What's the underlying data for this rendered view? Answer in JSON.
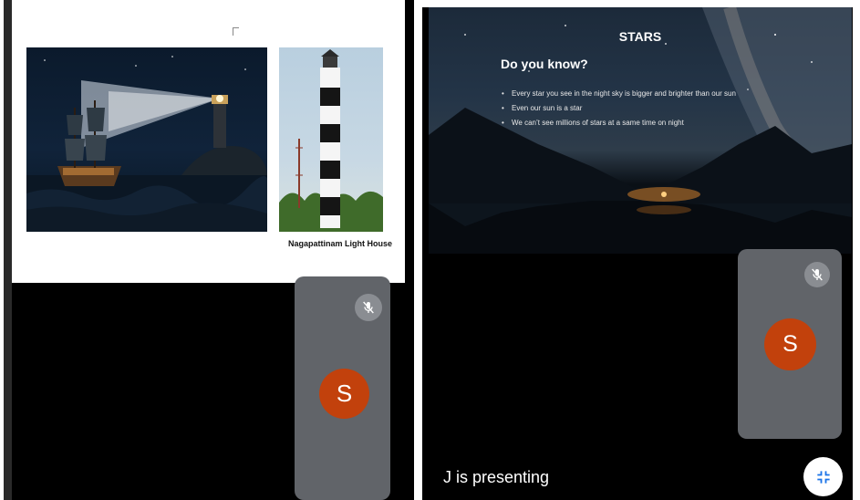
{
  "left_pane": {
    "slide": {
      "caption": "Nagapattinam Light House"
    },
    "participant_tile": {
      "avatar_initial": "S",
      "avatar_color": "#c2410c",
      "mic_icon": "mic-off-icon"
    }
  },
  "right_pane": {
    "slide": {
      "title": "STARS",
      "heading": "Do you know?",
      "bullets": [
        "Every star you see in the night sky is bigger and brighter than our sun",
        "Even our sun is a star",
        "We can’t see millions of stars at a same time on night"
      ]
    },
    "participant_tile": {
      "avatar_initial": "S",
      "avatar_color": "#c2410c",
      "mic_icon": "mic-off-icon"
    },
    "presenting_label": "J is presenting",
    "minimize_icon": "minimize-icon"
  },
  "colors": {
    "tile_bg": "#616469",
    "avatar": "#c2410c",
    "pane_bg": "#000000"
  }
}
